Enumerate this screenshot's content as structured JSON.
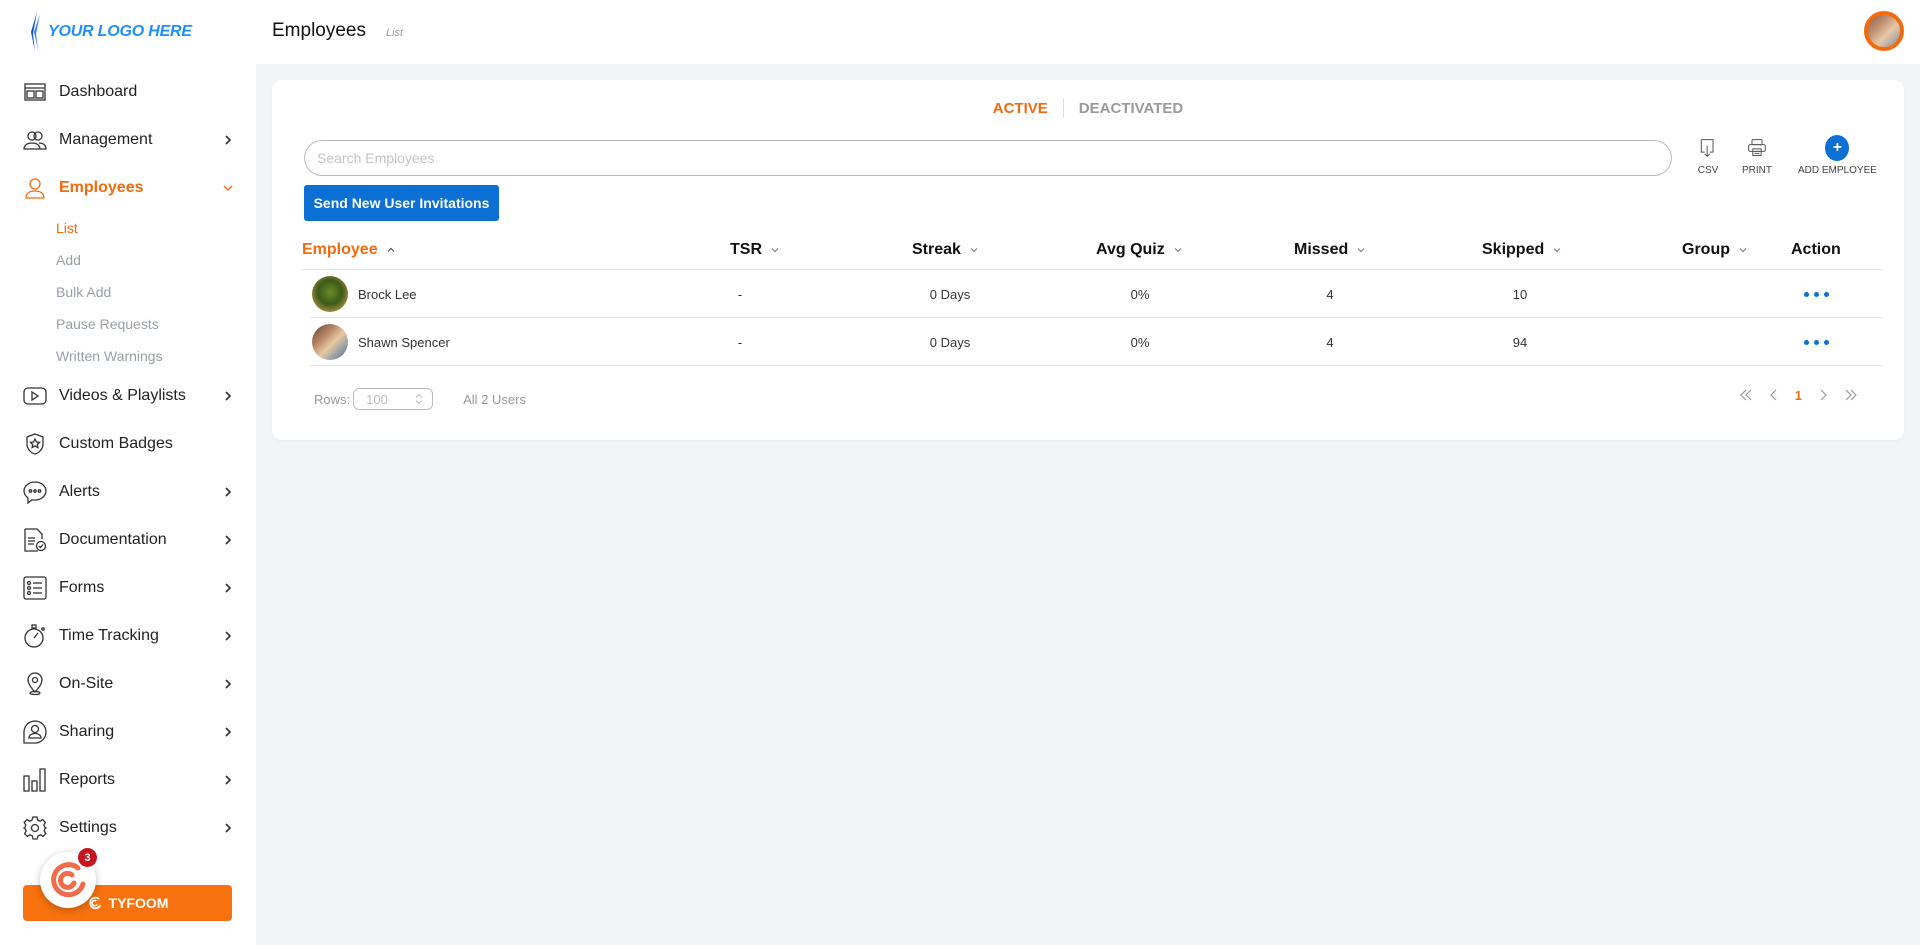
{
  "brand": {
    "logo_text": "YOUR LOGO HERE",
    "accent": "#f26b0f",
    "primary": "#0b6fd4"
  },
  "header": {
    "title": "Employees",
    "subtitle": "List"
  },
  "sidebar": {
    "items": [
      {
        "label": "Dashboard",
        "icon": "dashboard-icon",
        "has_chevron": false
      },
      {
        "label": "Management",
        "icon": "users-icon",
        "has_chevron": true
      },
      {
        "label": "Employees",
        "icon": "user-icon",
        "has_chevron": true,
        "active": true,
        "children": [
          "List",
          "Add",
          "Bulk Add",
          "Pause Requests",
          "Written Warnings"
        ],
        "active_child": "List"
      },
      {
        "label": "Videos & Playlists",
        "icon": "play-icon",
        "has_chevron": true
      },
      {
        "label": "Custom Badges",
        "icon": "badge-icon",
        "has_chevron": false
      },
      {
        "label": "Alerts",
        "icon": "chat-bubble-icon",
        "has_chevron": true
      },
      {
        "label": "Documentation",
        "icon": "document-check-icon",
        "has_chevron": true
      },
      {
        "label": "Forms",
        "icon": "form-list-icon",
        "has_chevron": true
      },
      {
        "label": "Time Tracking",
        "icon": "stopwatch-icon",
        "has_chevron": true
      },
      {
        "label": "On-Site",
        "icon": "location-pin-icon",
        "has_chevron": true
      },
      {
        "label": "Sharing",
        "icon": "share-user-icon",
        "has_chevron": true
      },
      {
        "label": "Reports",
        "icon": "bar-chart-icon",
        "has_chevron": true
      },
      {
        "label": "Settings",
        "icon": "gear-icon",
        "has_chevron": true
      }
    ],
    "tyfoom_button": "TYFOOM",
    "notification_count": "3"
  },
  "main": {
    "tabs": [
      {
        "label": "ACTIVE",
        "active": true
      },
      {
        "label": "DEACTIVATED",
        "active": false
      }
    ],
    "search": {
      "placeholder": "Search Employees",
      "value": ""
    },
    "tools": {
      "csv": "CSV",
      "print": "PRINT",
      "add": "ADD EMPLOYEE"
    },
    "invite_button": "Send New User Invitations",
    "table": {
      "columns": [
        "Employee",
        "TSR",
        "Streak",
        "Avg Quiz",
        "Missed",
        "Skipped",
        "Group",
        "Action"
      ],
      "sorted_column": "Employee",
      "rows": [
        {
          "name": "Brock Lee",
          "tsr": "-",
          "streak": "0 Days",
          "avg_quiz": "0%",
          "missed": "4",
          "skipped": "10",
          "group": ""
        },
        {
          "name": "Shawn Spencer",
          "tsr": "-",
          "streak": "0 Days",
          "avg_quiz": "0%",
          "missed": "4",
          "skipped": "94",
          "group": ""
        }
      ]
    },
    "footer": {
      "rows_label": "Rows:",
      "rows_value": "100",
      "user_count": "All 2 Users",
      "current_page": "1"
    }
  }
}
